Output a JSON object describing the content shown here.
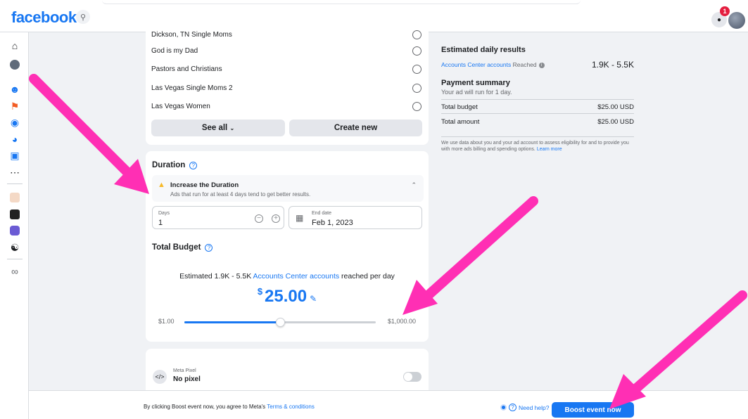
{
  "app": {
    "logo": "facebook",
    "notification_count": "1"
  },
  "audience": {
    "groups": [
      "Dickson, TN Single Moms",
      "God is my Dad",
      "Pastors and Christians",
      "Las Vegas Single Moms 2",
      "Las Vegas Women"
    ],
    "see_all": "See all",
    "create_new": "Create new"
  },
  "duration": {
    "title": "Duration",
    "warning_title": "Increase the Duration",
    "warning_text": "Ads that run for at least 4 days tend to get better results.",
    "days_label": "Days",
    "days_value": "1",
    "end_date_label": "End date",
    "end_date_value": "Feb 1, 2023"
  },
  "budget": {
    "title": "Total Budget",
    "estimate_prefix": "Estimated 1.9K - 5.5K",
    "estimate_link": "Accounts Center accounts",
    "estimate_suffix": "reached per day",
    "currency": "$",
    "amount": "25.00",
    "slider_min": "$1.00",
    "slider_max": "$1,000.00",
    "slider_fraction": 0.5
  },
  "pixel": {
    "label": "Meta Pixel",
    "value": "No pixel",
    "enabled": false
  },
  "results": {
    "title": "Estimated daily results",
    "reached_link": "Accounts Center accounts",
    "reached_label": "Reached",
    "reached_value": "1.9K - 5.5K"
  },
  "payment": {
    "title": "Payment summary",
    "subtitle": "Your ad will run for 1 day.",
    "total_budget_label": "Total budget",
    "total_budget_value": "$25.00 USD",
    "total_amount_label": "Total amount",
    "total_amount_value": "$25.00 USD",
    "disclaimer": "We use data about you and your ad account to assess eligibility for and to provide you with more ads billing and spending options.",
    "learn_more": "Learn more"
  },
  "footer": {
    "agree_text": "By clicking Boost event now, you agree to Meta's",
    "terms_link": "Terms & conditions",
    "need_help": "Need help?",
    "boost_button": "Boost event now"
  },
  "colors": {
    "brand": "#1877f2",
    "annotation": "#ff2fb4",
    "background": "#f0f2f5"
  }
}
